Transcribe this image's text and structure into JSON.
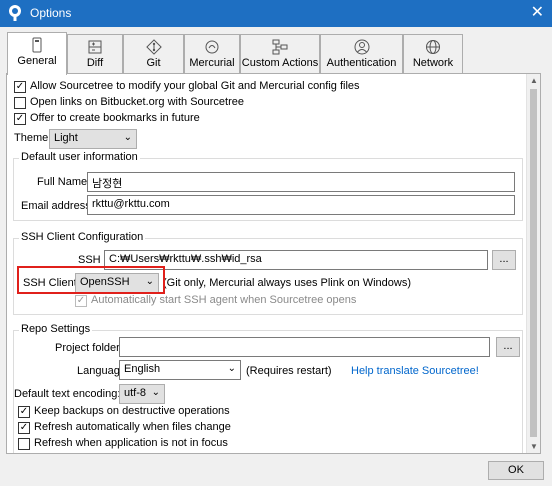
{
  "window": {
    "title": "Options",
    "close_glyph": "✕"
  },
  "tabs": [
    {
      "label": "General",
      "icon": "phone-icon",
      "active": true
    },
    {
      "label": "Diff",
      "icon": "diff-icon"
    },
    {
      "label": "Git",
      "icon": "git-icon"
    },
    {
      "label": "Mercurial",
      "icon": "mercurial-icon"
    },
    {
      "label": "Custom Actions",
      "icon": "flow-icon"
    },
    {
      "label": "Authentication",
      "icon": "user-icon"
    },
    {
      "label": "Network",
      "icon": "globe-icon"
    }
  ],
  "general": {
    "allow_config": {
      "label": "Allow Sourcetree to modify your global Git and Mercurial config files",
      "checked": true
    },
    "open_links": {
      "label": "Open links on Bitbucket.org with Sourcetree",
      "checked": false
    },
    "offer_bookmarks": {
      "label": "Offer to create bookmarks in future",
      "checked": true
    },
    "theme_label": "Theme:",
    "theme_value": "Light"
  },
  "user_info": {
    "title": "Default user information",
    "full_name_label": "Full Name:",
    "full_name_value": "남정현",
    "email_label": "Email address:",
    "email_value": "rkttu@rkttu.com"
  },
  "ssh": {
    "title": "SSH Client Configuration",
    "key_label": "SSH Key:",
    "key_value": "C:₩Users₩rkttu₩.ssh₩id_rsa",
    "browse": "...",
    "client_label": "SSH Client:",
    "client_value": "OpenSSH",
    "client_note": "(Git only, Mercurial always uses Plink on Windows)",
    "auto_agent": {
      "label": "Automatically start SSH agent when Sourcetree opens",
      "checked": true
    }
  },
  "repo": {
    "title": "Repo Settings",
    "project_folder_label": "Project folder:",
    "project_folder_value": "",
    "browse": "...",
    "language_label": "Language:",
    "language_value": "English",
    "language_note": "(Requires restart)",
    "translate_link": "Help translate Sourcetree!",
    "encoding_label": "Default text encoding:",
    "encoding_value": "utf-8",
    "keep_backups": {
      "label": "Keep backups on destructive operations",
      "checked": true
    },
    "refresh_auto": {
      "label": "Refresh automatically when files change",
      "checked": true
    },
    "refresh_focus": {
      "label": "Refresh when application is not in focus",
      "checked": false
    }
  },
  "footer": {
    "ok": "OK"
  },
  "colors": {
    "titlebar": "#1e6fc2",
    "highlight": "#e0201b",
    "link": "#0066cc"
  }
}
